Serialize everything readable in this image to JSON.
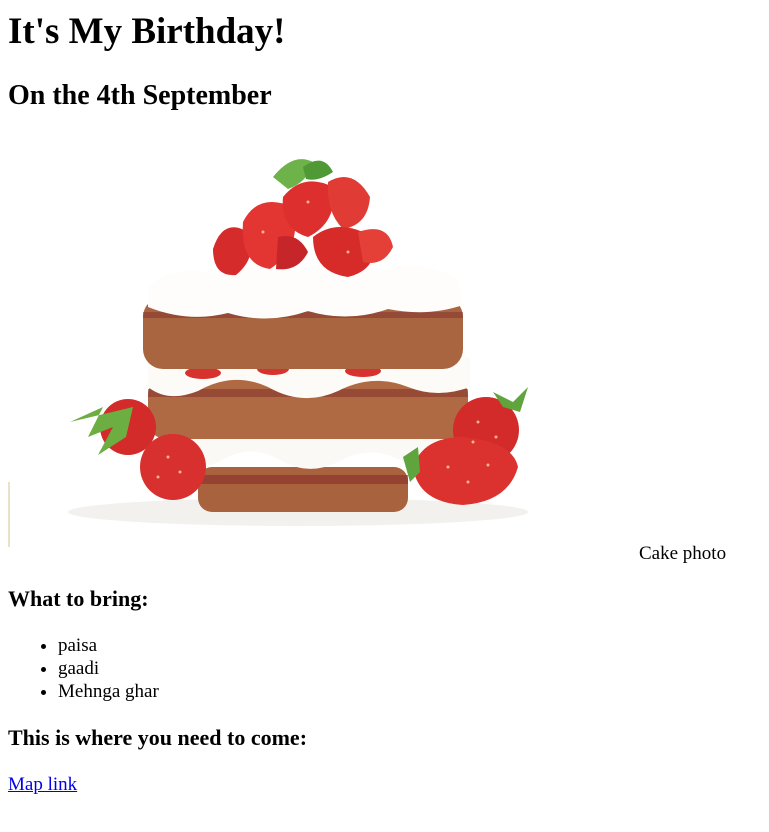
{
  "page": {
    "title": "It's My Birthday!",
    "subtitle": "On the 4th September",
    "image_caption": "Cake photo",
    "bring_heading": "What to bring:",
    "bring_items": [
      "paisa",
      "gaadi",
      "Mehnga ghar"
    ],
    "where_heading": "This is where you need to come:",
    "map_link_text": "Map link"
  },
  "colors": {
    "link": "#0000ee",
    "text": "#000000"
  }
}
